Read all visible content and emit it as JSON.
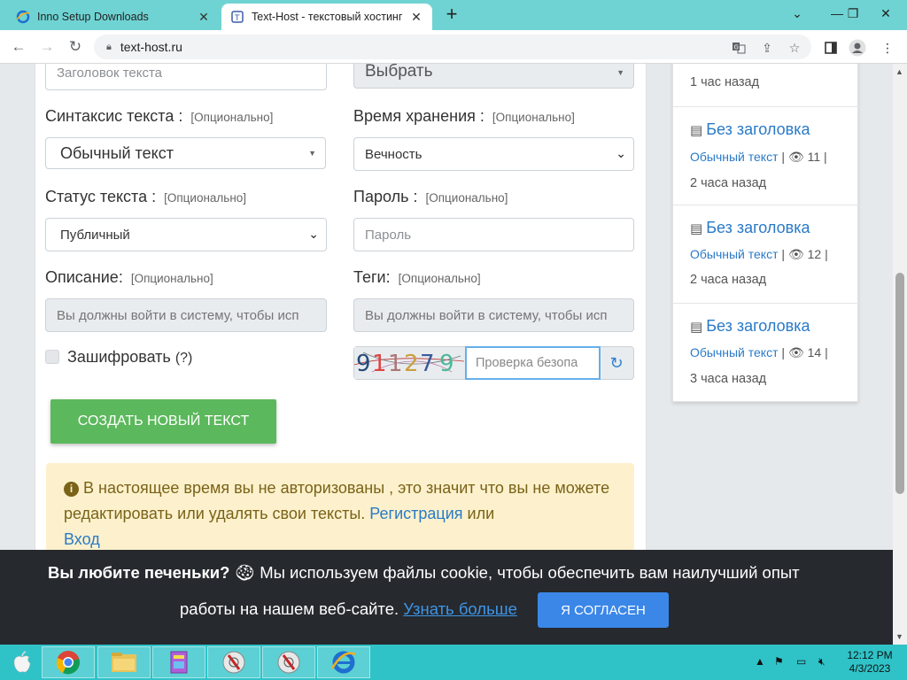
{
  "browser": {
    "tabs": [
      {
        "title": "Inno Setup Downloads",
        "active": false
      },
      {
        "title": "Text-Host - текстовый хостинг",
        "active": true
      }
    ],
    "url": "text-host.ru"
  },
  "form": {
    "title_placeholder": "Заголовок текста",
    "category_select": "Выбрать",
    "syntax_label": "Синтаксис текста :",
    "syntax_optional": "[Опционально]",
    "syntax_value": "Обычный текст",
    "expiry_label": "Время хранения :",
    "expiry_optional": "[Опционально]",
    "expiry_value": "Вечность",
    "status_label": "Статус текста :",
    "status_optional": "[Опционально]",
    "status_value": "Публичный",
    "password_label": "Пароль :",
    "password_optional": "[Опционально]",
    "password_placeholder": "Пароль",
    "description_label": "Описание:",
    "description_optional": "[Опционально]",
    "description_disabled": "Вы должны войти в систему, чтобы исп",
    "tags_label": "Теги:",
    "tags_optional": "[Опционально]",
    "tags_disabled": "Вы должны войти в систему, чтобы исп",
    "encrypt_label": "Зашифровать",
    "encrypt_help": "(?)",
    "captcha_code": "911279",
    "captcha_placeholder": "Проверка безопа",
    "create_button": "СОЗДАТЬ НОВЫЙ ТЕКСТ"
  },
  "alert": {
    "text": "В настоящее время вы не авторизованы , это значит что вы не можете редактировать или удалять свои тексты.",
    "register_link": "Регистрация",
    "or": "или",
    "login_link": "Вход"
  },
  "sidebar": {
    "first_time": "1 час назад",
    "items": [
      {
        "title": "Без заголовка",
        "syntax": "Обычный текст",
        "views": "11",
        "time": "2 часа назад"
      },
      {
        "title": "Без заголовка",
        "syntax": "Обычный текст",
        "views": "12",
        "time": "2 часа назад"
      },
      {
        "title": "Без заголовка",
        "syntax": "Обычный текст",
        "views": "14",
        "time": "3 часа назад"
      }
    ]
  },
  "cookie": {
    "heading": "Вы любите печеньки?",
    "line1": "Мы используем файлы cookie, чтобы обеспечить вам наилучший опыт",
    "line2": "работы на нашем веб-сайте.",
    "learn_more": "Узнать больше",
    "accept_button": "Я СОГЛАСЕН"
  },
  "taskbar": {
    "time": "12:12 PM",
    "date": "4/3/2023"
  },
  "colors": {
    "tabbar": "#6fd3d3",
    "button_green": "#5cb85c",
    "link_blue": "#2a7ac7",
    "alert_bg": "#fcf1cc",
    "cookie_bg": "#26292e",
    "accept_blue": "#3a87e8",
    "taskbar": "#2fc3c8"
  },
  "icons": [
    "ie-icon",
    "text-host-icon",
    "close-icon",
    "plus-icon",
    "back-icon",
    "forward-icon",
    "reload-icon",
    "lock-icon",
    "translate-icon",
    "share-icon",
    "star-icon",
    "sidebar-icon",
    "profile-icon",
    "menu-icon",
    "info-icon",
    "refresh-icon",
    "document-icon",
    "eye-icon",
    "cookie-icon",
    "apple-icon",
    "chrome-icon",
    "folder-icon"
  ]
}
